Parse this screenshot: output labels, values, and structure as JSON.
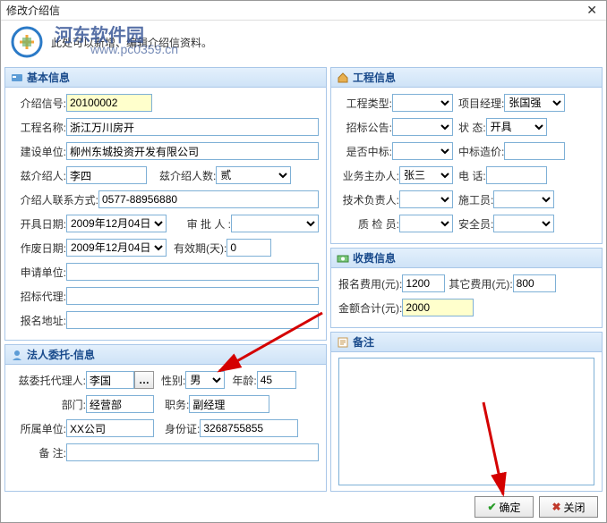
{
  "window": {
    "title": "修改介绍信"
  },
  "header": {
    "desc": "此处可以新增、编辑介绍信资料。"
  },
  "watermark": {
    "site": "河东软件园",
    "url": "www.pc0359.cn"
  },
  "panels": {
    "basic": {
      "title": "基本信息"
    },
    "legal": {
      "title": "法人委托-信息"
    },
    "project": {
      "title": "工程信息"
    },
    "fee": {
      "title": "收费信息"
    },
    "remark": {
      "title": "备注"
    }
  },
  "basic": {
    "letter_no_label": "介绍信号:",
    "letter_no": "20100002",
    "proj_name_label": "工程名称:",
    "proj_name": "浙江万川房开",
    "build_unit_label": "建设单位:",
    "build_unit": "柳州东城投资开发有限公司",
    "introducer_label": "兹介绍人:",
    "introducer": "李四",
    "intro_count_label": "兹介绍人数:",
    "intro_count": "贰",
    "contact_label": "介绍人联系方式:",
    "contact": "0577-88956880",
    "issue_date_label": "开具日期:",
    "issue_date": "2009年12月04日",
    "approver_label": "审 批 人 :",
    "approver": "",
    "void_date_label": "作废日期:",
    "void_date": "2009年12月04日",
    "valid_days_label": "有效期(天):",
    "valid_days": "0",
    "apply_unit_label": "申请单位:",
    "apply_unit": "",
    "bid_agent_label": "招标代理:",
    "bid_agent": "",
    "addr_label": "报名地址:",
    "addr": ""
  },
  "legal": {
    "agent_label": "兹委托代理人:",
    "agent": "李国",
    "gender_label": "性别:",
    "gender": "男",
    "age_label": "年龄:",
    "age": "45",
    "dept_label": "部门:",
    "dept": "经营部",
    "post_label": "职务:",
    "post": "副经理",
    "unit_label": "所属单位:",
    "unit": "XX公司",
    "idcard_label": "身份证:",
    "idcard": "3268755855",
    "remark_label": "备    注:",
    "remark": ""
  },
  "project": {
    "type_label": "工程类型:",
    "type": "",
    "pm_label": "项目经理:",
    "pm": "张国强",
    "tender_label": "招标公告:",
    "tender": "",
    "status_label": "状        态:",
    "status": "开具",
    "winbid_label": "是否中标:",
    "winbid": "",
    "price_label": "中标造价:",
    "price": "",
    "owner_label": "业务主办人:",
    "owner": "张三",
    "phone_label": "电    话:",
    "phone": "",
    "tech_label": "技术负责人:",
    "tech": "",
    "builder_label": "施工员:",
    "builder": "",
    "qc_label": "质   检   员:",
    "qc": "",
    "safety_label": "安全员:",
    "safety": ""
  },
  "fee": {
    "reg_label": "报名费用(元):",
    "reg": "1200",
    "other_label": "其它费用(元):",
    "other": "800",
    "total_label": "金额合计(元):",
    "total": "2000"
  },
  "buttons": {
    "ok": "确定",
    "close": "关闭"
  }
}
